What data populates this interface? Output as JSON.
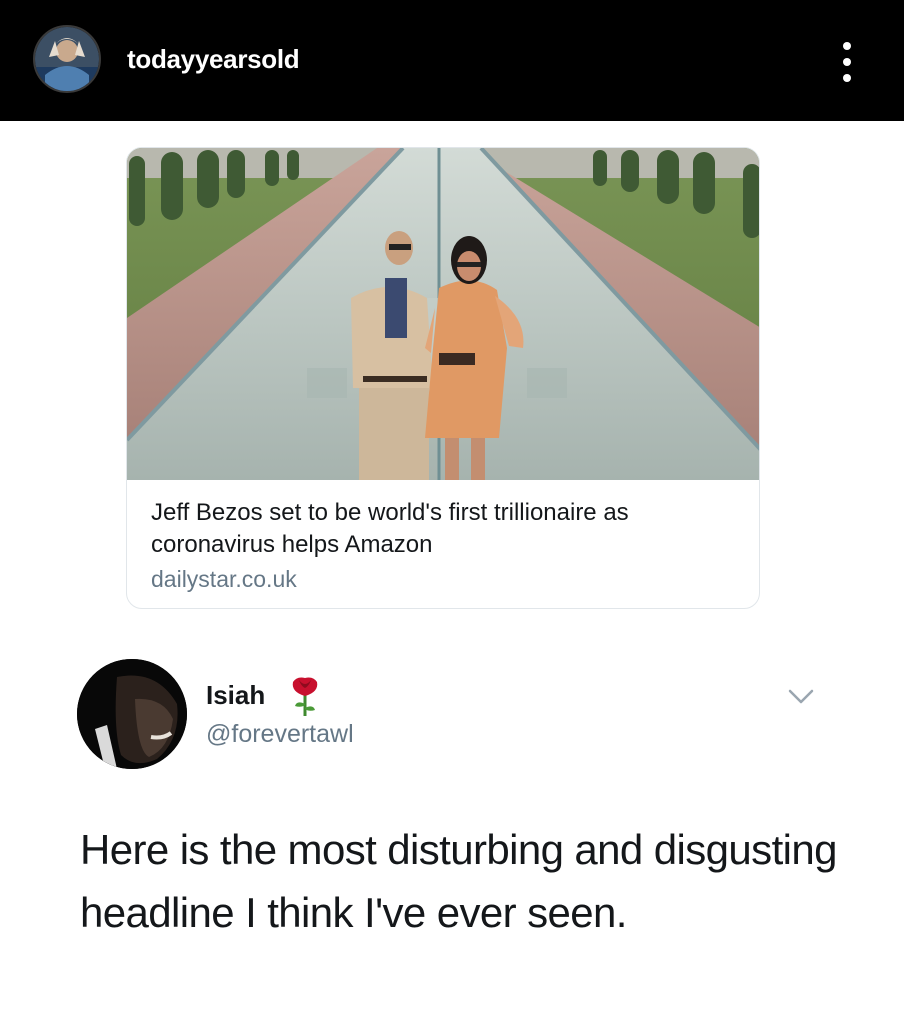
{
  "post_header": {
    "username": "todayyearsold",
    "avatar_icon": "profile-avatar",
    "more_icon": "more-vertical-icon"
  },
  "tweet": {
    "author_name": "Isiah",
    "author_emoji": "rose-icon",
    "author_handle": "@forevertawl",
    "menu_icon": "chevron-down-icon",
    "text": "Here is the most disturbing and disgusting headline I think I've ever seen."
  },
  "link_card": {
    "title": "Jeff Bezos set to be world's first trillionaire as coronavirus helps Amazon",
    "domain": "dailystar.co.uk"
  },
  "colors": {
    "header_bg": "#000000",
    "text_primary": "#14171a",
    "text_secondary": "#657786",
    "card_border": "#e1e6ea"
  }
}
